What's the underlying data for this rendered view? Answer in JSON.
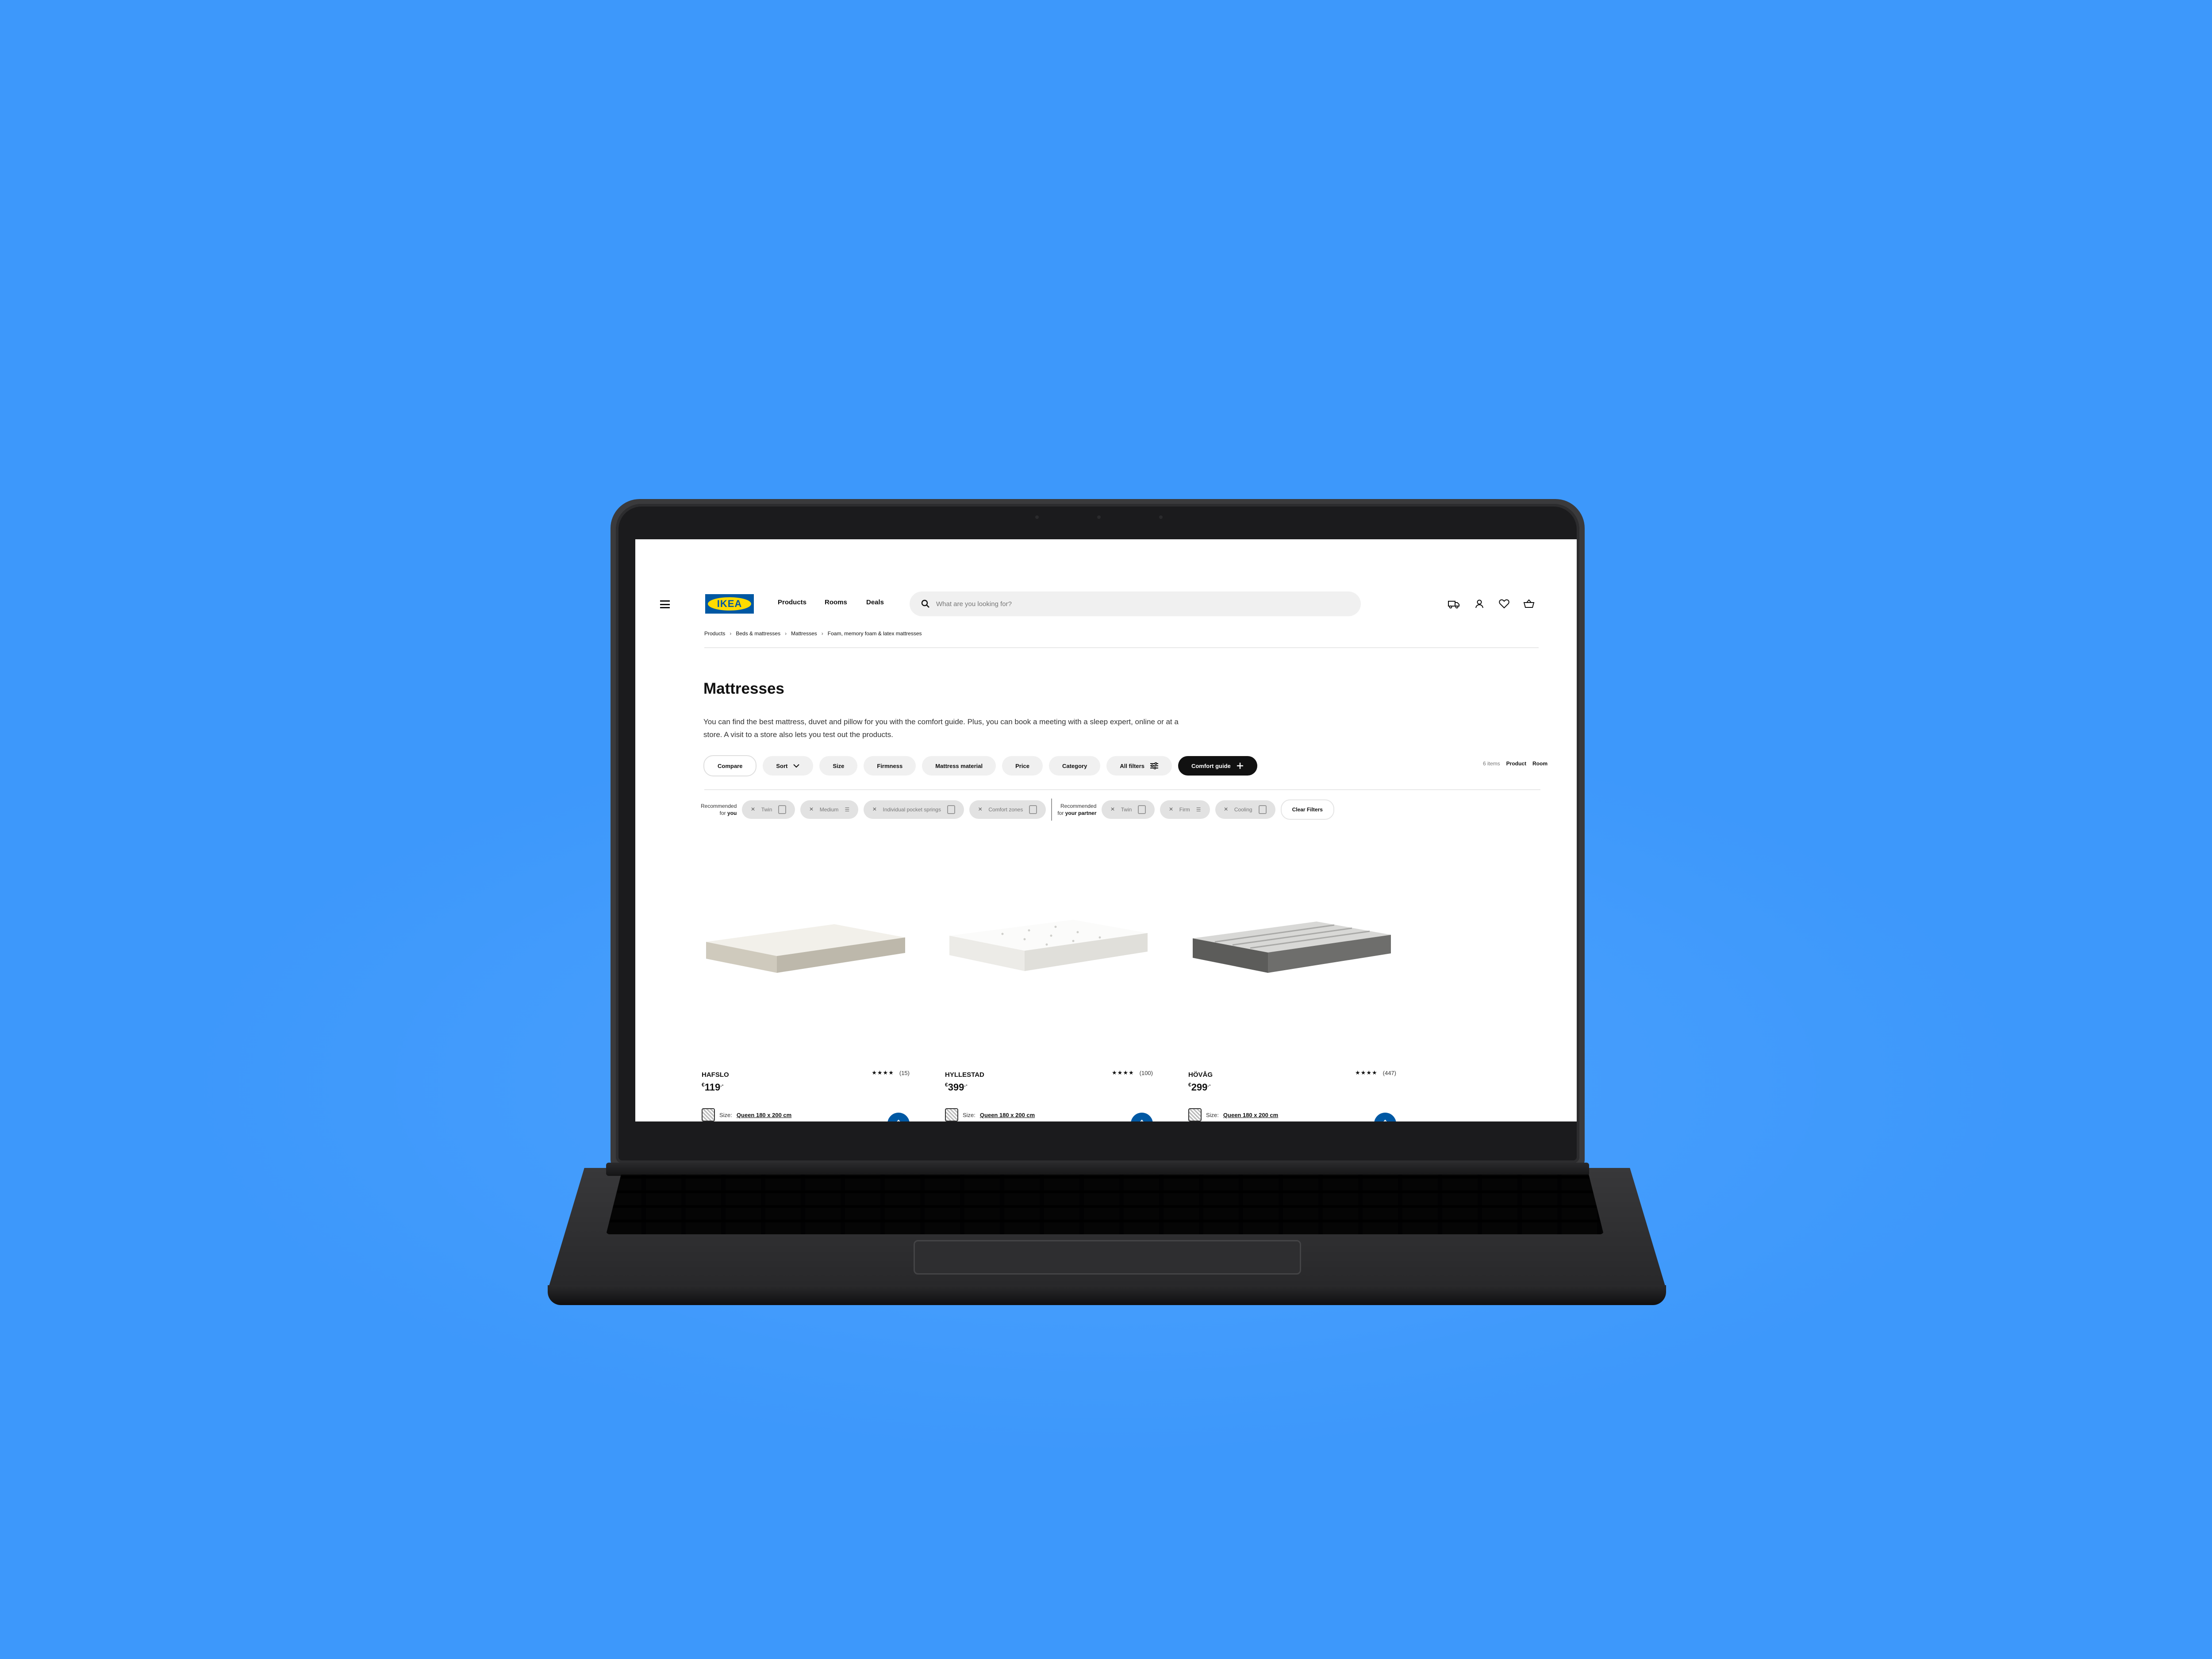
{
  "header": {
    "nav": [
      "Products",
      "Rooms",
      "Deals"
    ],
    "search_placeholder": "What are you looking for?",
    "logo_text": "IKEA"
  },
  "breadcrumb": [
    "Products",
    "Beds & mattresses",
    "Mattresses",
    "Foam, memory foam & latex mattresses"
  ],
  "page": {
    "title": "Mattresses",
    "intro": "You can find the best mattress, duvet and pillow for you with the comfort guide. Plus, you can book a meeting with a sleep expert, online or at a store. A visit to a store also lets you test out the products."
  },
  "filters": {
    "compare": "Compare",
    "sort": "Sort",
    "size": "Size",
    "firmness": "Firmness",
    "material": "Mattress material",
    "price": "Price",
    "category": "Category",
    "all_filters": "All filters",
    "comfort_guide": "Comfort guide"
  },
  "view": {
    "count": "6 items",
    "product": "Product",
    "room": "Room"
  },
  "recommended": {
    "you_label_1": "Recommended",
    "you_label_2": "for",
    "you_label_bold": "you",
    "you_chips": [
      "Twin",
      "Medium",
      "Individual pocket springs",
      "Comfort zones"
    ],
    "partner_label_1": "Recommended",
    "partner_label_2": "for",
    "partner_label_bold": "your partner",
    "partner_chips": [
      "Twin",
      "Firm",
      "Cooling"
    ],
    "clear": "Clear Filters"
  },
  "products": [
    {
      "name": "HAFSLO",
      "currency": "€",
      "price": "119",
      "suffix": ".-",
      "stars": "★★★★",
      "reviews": "(15)",
      "size_label": "Size:",
      "size_value": "Queen 180 x 200 cm",
      "color": "#e6e3dc"
    },
    {
      "name": "HYLLESTAD",
      "currency": "€",
      "price": "399",
      "suffix": ".-",
      "stars": "★★★★",
      "reviews": "(100)",
      "size_label": "Size:",
      "size_value": "Queen 180 x 200 cm",
      "color": "#f3f3f1"
    },
    {
      "name": "HÖVÅG",
      "currency": "€",
      "price": "299",
      "suffix": ".-",
      "stars": "★★★★",
      "reviews": "(447)",
      "size_label": "Size:",
      "size_value": "Queen 180 x 200 cm",
      "color": "#8a8a88"
    }
  ],
  "colors": {
    "background": "#3d98fb",
    "ikea_blue": "#0058a3",
    "ikea_yellow": "#ffdb00"
  }
}
